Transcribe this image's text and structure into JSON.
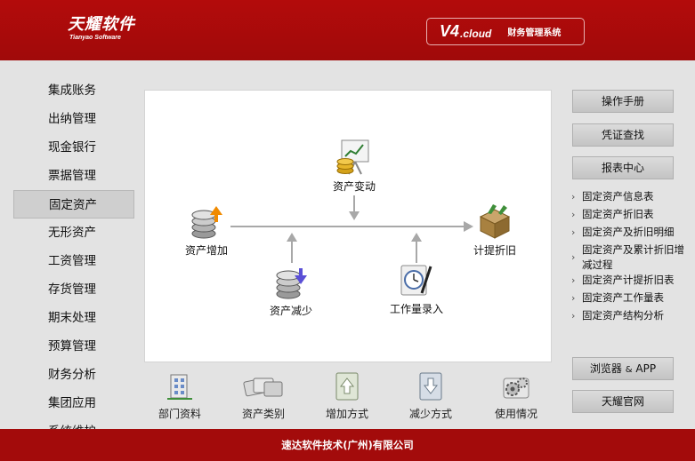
{
  "header": {
    "logo_main": "天耀软件",
    "logo_sub": "Tianyao Software",
    "version_num": "V4",
    "version_suffix": ".cloud",
    "version_title": "财务管理系统"
  },
  "nav": {
    "items": [
      {
        "label": "集成账务"
      },
      {
        "label": "出纳管理"
      },
      {
        "label": "现金银行"
      },
      {
        "label": "票据管理"
      },
      {
        "label": "固定资产",
        "active": true
      },
      {
        "label": "无形资产"
      },
      {
        "label": "工资管理"
      },
      {
        "label": "存货管理"
      },
      {
        "label": "期末处理"
      },
      {
        "label": "预算管理"
      },
      {
        "label": "财务分析"
      },
      {
        "label": "集团应用"
      },
      {
        "label": "系统维护"
      }
    ]
  },
  "flow": {
    "asset_change": "资产变动",
    "asset_add": "资产增加",
    "asset_reduce": "资产减少",
    "workload_entry": "工作量录入",
    "depreciation": "计提折旧"
  },
  "toolbar": {
    "items": [
      {
        "label": "部门资料",
        "icon": "building-icon"
      },
      {
        "label": "资产类别",
        "icon": "cards-icon"
      },
      {
        "label": "增加方式",
        "icon": "doc-up-icon"
      },
      {
        "label": "减少方式",
        "icon": "doc-down-icon"
      },
      {
        "label": "使用情况",
        "icon": "gears-icon"
      }
    ]
  },
  "right": {
    "manual": "操作手册",
    "voucher_search": "凭证查找",
    "report_center": "报表中心",
    "reports": [
      "固定资产信息表",
      "固定资产折旧表",
      "固定资产及折旧明细",
      "固定资产及累计折旧增减过程",
      "固定资产计提折旧表",
      "固定资产工作量表",
      "固定资产结构分析"
    ],
    "browser_app_1": "浏览器",
    "browser_app_amp": "&",
    "browser_app_2": "APP",
    "official_site": "天耀官网"
  },
  "footer": {
    "company": "速达软件技术(广州)有限公司"
  },
  "colors": {
    "header_red": "#a80a0a",
    "footer_red": "#a30b0b",
    "background": "#e3e3e3"
  }
}
